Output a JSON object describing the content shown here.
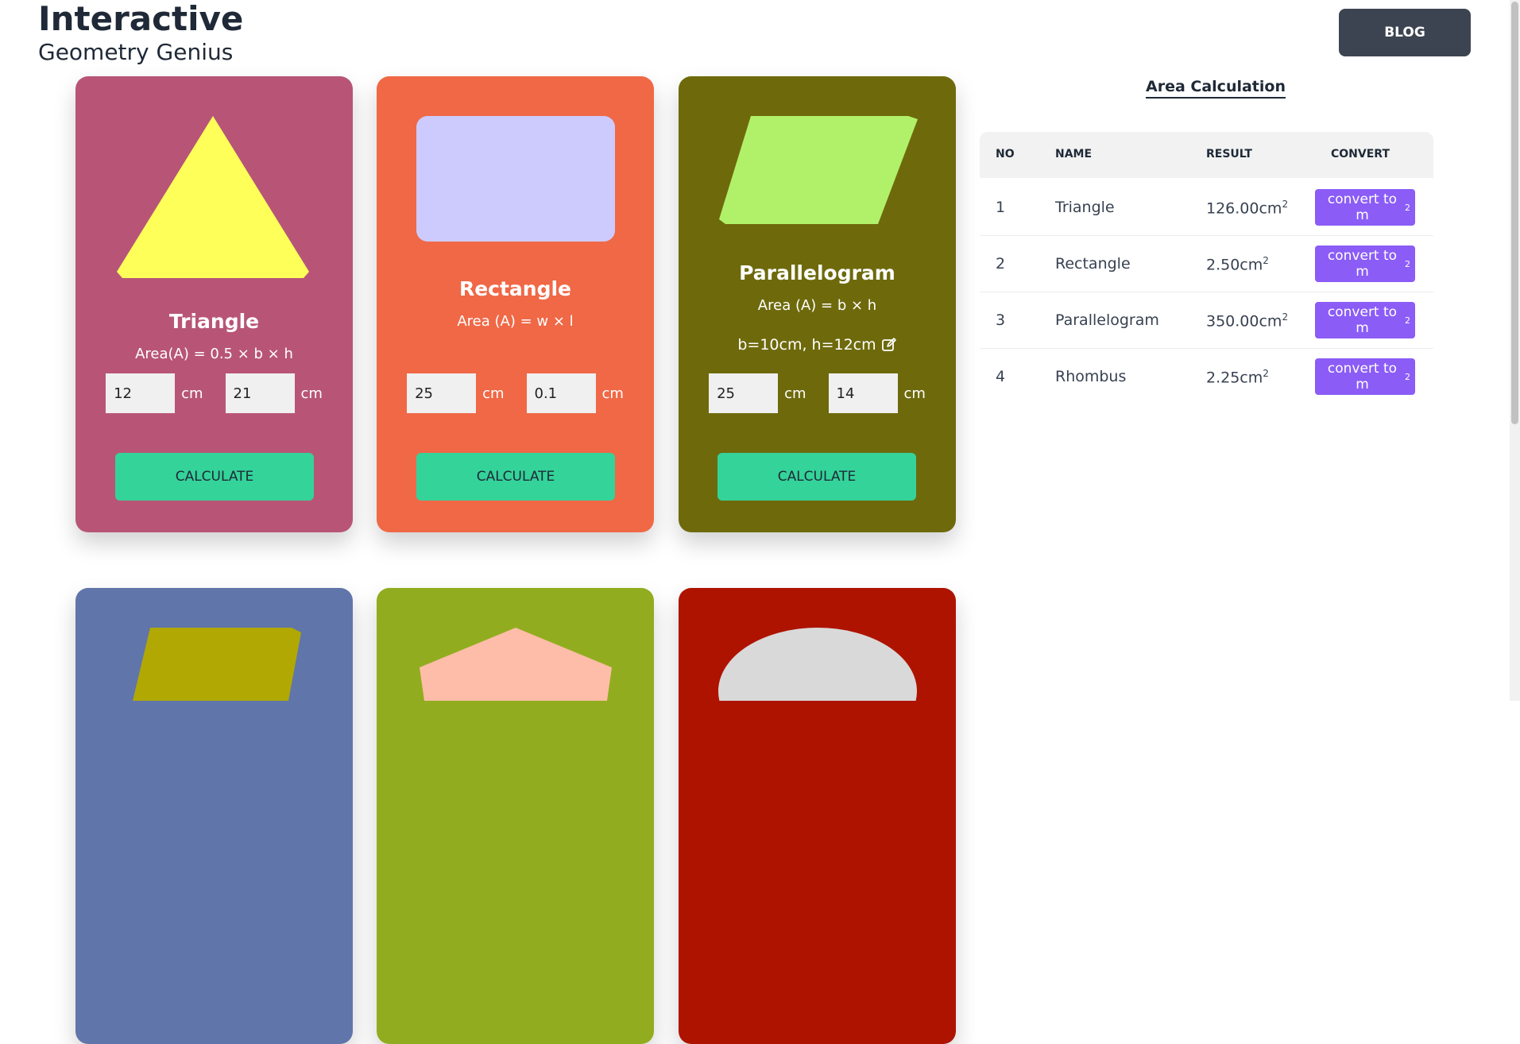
{
  "brand": {
    "title": "Interactive",
    "subtitle": "Geometry Genius"
  },
  "header": {
    "blog_label": "BLOG"
  },
  "cards": [
    {
      "title": "Triangle",
      "formula": "Area(A) = 0.5 × b × h",
      "input1": "12",
      "input2": "21",
      "unit": "cm",
      "button": "CALCULATE",
      "bg": "#b85577",
      "shape_color": "#ffff5a"
    },
    {
      "title": "Rectangle",
      "formula": "Area (A) = w × l",
      "input1": "25",
      "input2": "0.1",
      "unit": "cm",
      "button": "CALCULATE",
      "bg": "#f06846",
      "shape_color": "#cdcbfd"
    },
    {
      "title": "Parallelogram",
      "formula": "Area (A) = b × h",
      "dims": "b=10cm, h=12cm",
      "input1": "25",
      "input2": "14",
      "unit": "cm",
      "button": "CALCULATE",
      "bg": "#6e6a0c",
      "shape_color": "#b1f16a"
    },
    {
      "bg": "#6075aa",
      "shape_color": "#b1a804"
    },
    {
      "bg": "#91ad1f",
      "shape_color": "#febda8"
    },
    {
      "bg": "#ae1300",
      "shape_color": "#d9d9d9"
    }
  ],
  "table": {
    "title": "Area Calculation",
    "headers": {
      "no": "NO",
      "name": "NAME",
      "result": "RESULT",
      "convert": "CONVERT"
    },
    "rows": [
      {
        "no": "1",
        "name": "Triangle",
        "result": "126.00cm",
        "sup": "2",
        "convert": "convert to m",
        "convert_sup": "2"
      },
      {
        "no": "2",
        "name": "Rectangle",
        "result": "2.50cm",
        "sup": "2",
        "convert": "convert to m",
        "convert_sup": "2"
      },
      {
        "no": "3",
        "name": "Parallelogram",
        "result": "350.00cm",
        "sup": "2",
        "convert": "convert to m",
        "convert_sup": "2"
      },
      {
        "no": "4",
        "name": "Rhombus",
        "result": "2.25cm",
        "sup": "2",
        "convert": "convert to m",
        "convert_sup": "2"
      }
    ]
  }
}
